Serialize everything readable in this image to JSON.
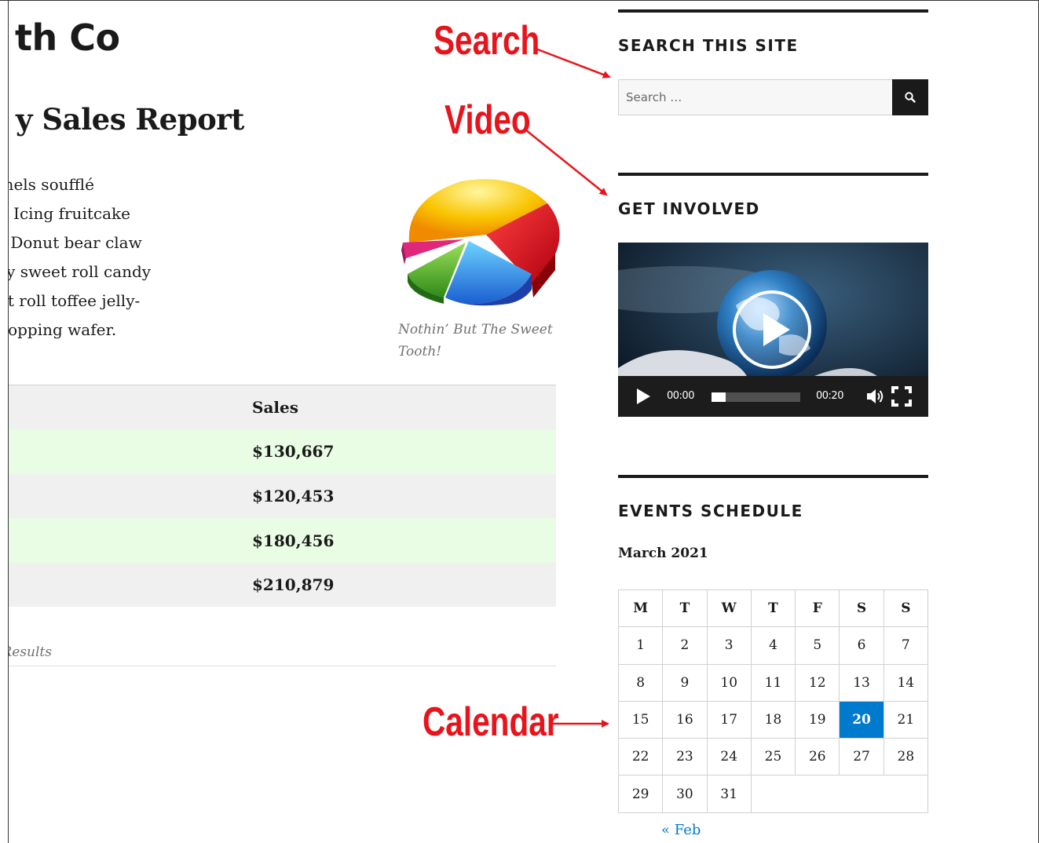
{
  "site": {
    "title_fragment": "th Co"
  },
  "article": {
    "title_fragment": "y Sales Report",
    "body_lines": [
      "t cookie biscuit muffin. Caramels soufflé",
      " chocolate bar danish lollipop. Icing fruitcake",
      "nacaroon tootsie roll jujubes. Donut bear claw",
      "prownie dessert. Donut pastry sweet roll candy",
      "nes tootsie roll dessert. Sweet roll toffee jelly-",
      "e. Carrot cake jelly oat cake topping wafer."
    ],
    "image_caption": "Nothin’ But The Sweet Tooth!",
    "table": {
      "header": "Sales",
      "rows": [
        "$130,667",
        "$120,453",
        "$180,456",
        "$210,879"
      ]
    },
    "table_caption_fragment": "Results"
  },
  "sidebar": {
    "search_widget": {
      "title": "SEARCH THIS SITE",
      "placeholder": "Search …"
    },
    "video_widget": {
      "title": "GET INVOLVED",
      "current_time": "00:00",
      "duration": "00:20",
      "progress": 0.16
    },
    "events_widget": {
      "title": "EVENTS SCHEDULE",
      "month_caption": "March 2021",
      "weekdays": [
        "M",
        "T",
        "W",
        "T",
        "F",
        "S",
        "S"
      ],
      "weeks": [
        [
          "1",
          "2",
          "3",
          "4",
          "5",
          "6",
          "7"
        ],
        [
          "8",
          "9",
          "10",
          "11",
          "12",
          "13",
          "14"
        ],
        [
          "15",
          "16",
          "17",
          "18",
          "19",
          "20",
          "21"
        ],
        [
          "22",
          "23",
          "24",
          "25",
          "26",
          "27",
          "28"
        ],
        [
          "29",
          "30",
          "31",
          "",
          "",
          "",
          ""
        ]
      ],
      "today": "20",
      "prev_link": "« Feb"
    }
  },
  "annotations": {
    "search": "Search",
    "video": "Video",
    "calendar": "Calendar",
    "color": "#e8141c"
  },
  "colors": {
    "accent": "#007acc",
    "row_green": "#e9fce4",
    "row_grey": "#f0f0f0"
  },
  "icons": {
    "search": "magnifier-icon",
    "play": "play-icon",
    "volume": "volume-icon",
    "fullscreen": "fullscreen-icon"
  }
}
